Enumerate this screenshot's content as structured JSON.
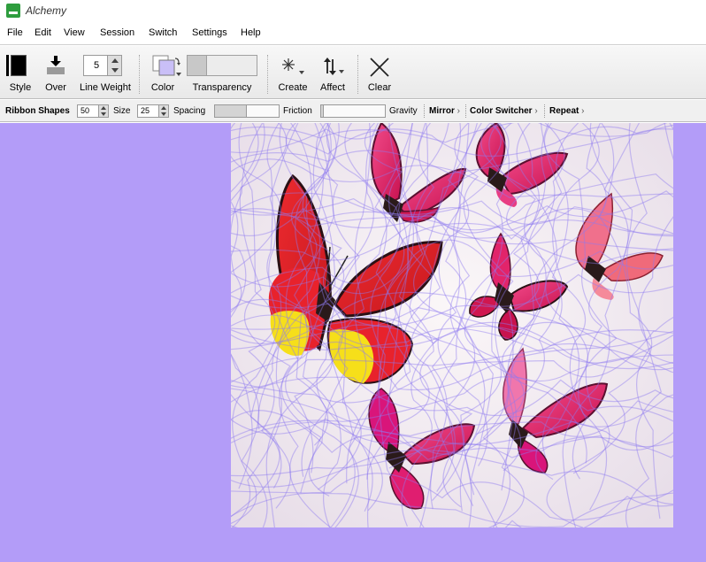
{
  "window": {
    "title": "Alchemy"
  },
  "menu": [
    "File",
    "Edit",
    "View",
    "Session",
    "Switch",
    "Settings",
    "Help"
  ],
  "toolbar": {
    "style_label": "Style",
    "over_label": "Over",
    "line_weight_label": "Line Weight",
    "line_weight_value": "5",
    "color_label": "Color",
    "transparency_label": "Transparency",
    "transparency_level": 0.28,
    "create_label": "Create",
    "affect_label": "Affect",
    "clear_label": "Clear"
  },
  "options": {
    "shape_name": "Ribbon Shapes",
    "shape_count": "50",
    "size_label": "Size",
    "size_value": "25",
    "spacing_label": "Spacing",
    "spacing_level": 0.5,
    "friction_label": "Friction",
    "friction_level": 0.04,
    "gravity_label": "Gravity",
    "mirror_label": "Mirror",
    "color_switcher_label": "Color Switcher",
    "repeat_label": "Repeat"
  },
  "colors": {
    "canvas_background": "#b39cf8",
    "stroke": "#8f7af0",
    "butterfly_pink": "#e0225f",
    "butterfly_red": "#e8252f",
    "butterfly_yellow": "#f4dc1a"
  }
}
